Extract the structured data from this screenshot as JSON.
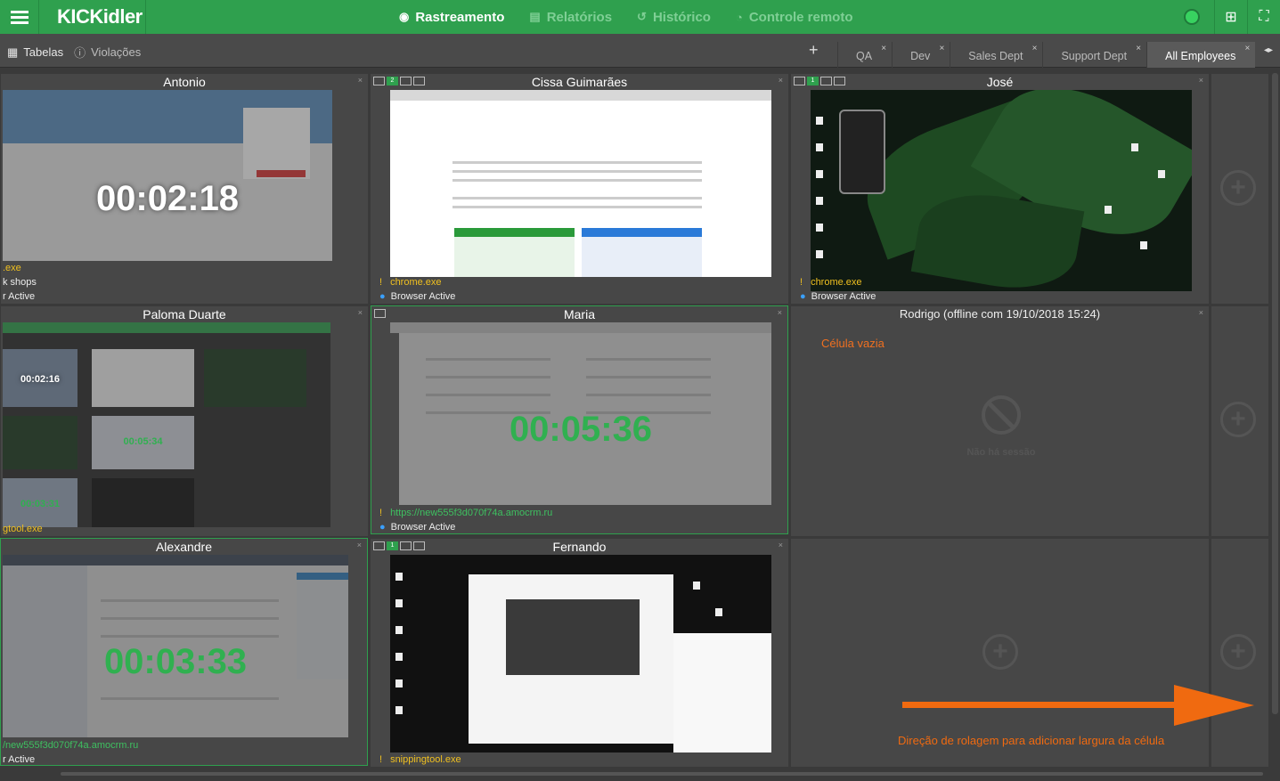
{
  "app": {
    "logo": "KICKidler",
    "nav": [
      {
        "label": "Rastreamento",
        "icon": "eye-icon",
        "active": true
      },
      {
        "label": "Relatórios",
        "icon": "document-icon",
        "active": false
      },
      {
        "label": "Histórico",
        "icon": "history-icon",
        "active": false
      },
      {
        "label": "Controle remoto",
        "icon": "remote-icon",
        "active": false
      }
    ],
    "accent": "#2fa04e"
  },
  "toolbar": {
    "tables_label": "Tabelas",
    "violations_label": "Violações",
    "add_tab": "+",
    "tabs": [
      {
        "label": "QA",
        "active": false
      },
      {
        "label": "Dev",
        "active": false
      },
      {
        "label": "Sales Dept",
        "active": false
      },
      {
        "label": "Support Dept",
        "active": false
      },
      {
        "label": "All Employees",
        "active": true
      }
    ],
    "tab_close": "×",
    "tab_scroll": "◂▸"
  },
  "cells": {
    "antonio": {
      "name": "Antonio",
      "timer": "00:02:18",
      "process": ".exe",
      "line2": "k shops",
      "state": "r Active"
    },
    "cissa": {
      "name": "Cissa Guimarães",
      "badge": "2",
      "process": "chrome.exe",
      "state": "Browser Active"
    },
    "jose": {
      "name": "José",
      "badge": "1",
      "process": "chrome.exe",
      "state": "Browser Active"
    },
    "paloma": {
      "name": "Paloma Duarte",
      "timer_a": "00:02:16",
      "timer_b": "00:05:34",
      "timer_c": "00:03:31",
      "process": "gtool.exe"
    },
    "maria": {
      "name": "Maria",
      "timer": "00:05:36",
      "process": "https://new555f3d070f74a.amocrm.ru",
      "state": "Browser Active"
    },
    "rodrigo": {
      "name": "Rodrigo (offline com 19/10/2018 15:24)",
      "empty_label": "Célula vazia",
      "no_session": "Não há sessão"
    },
    "alexandre": {
      "name": "Alexandre",
      "timer": "00:03:33",
      "process": "/new555f3d070f74a.amocrm.ru",
      "state": "r Active"
    },
    "fernando": {
      "name": "Fernando",
      "badge": "1",
      "process": "snippingtool.exe"
    }
  },
  "annotation": {
    "text": "Direção de rolagem para adicionar largura da célula",
    "color": "#f06a10"
  },
  "add_symbol": "+",
  "close_symbol": "×",
  "warn_symbol": "!",
  "dot_symbol": "●"
}
